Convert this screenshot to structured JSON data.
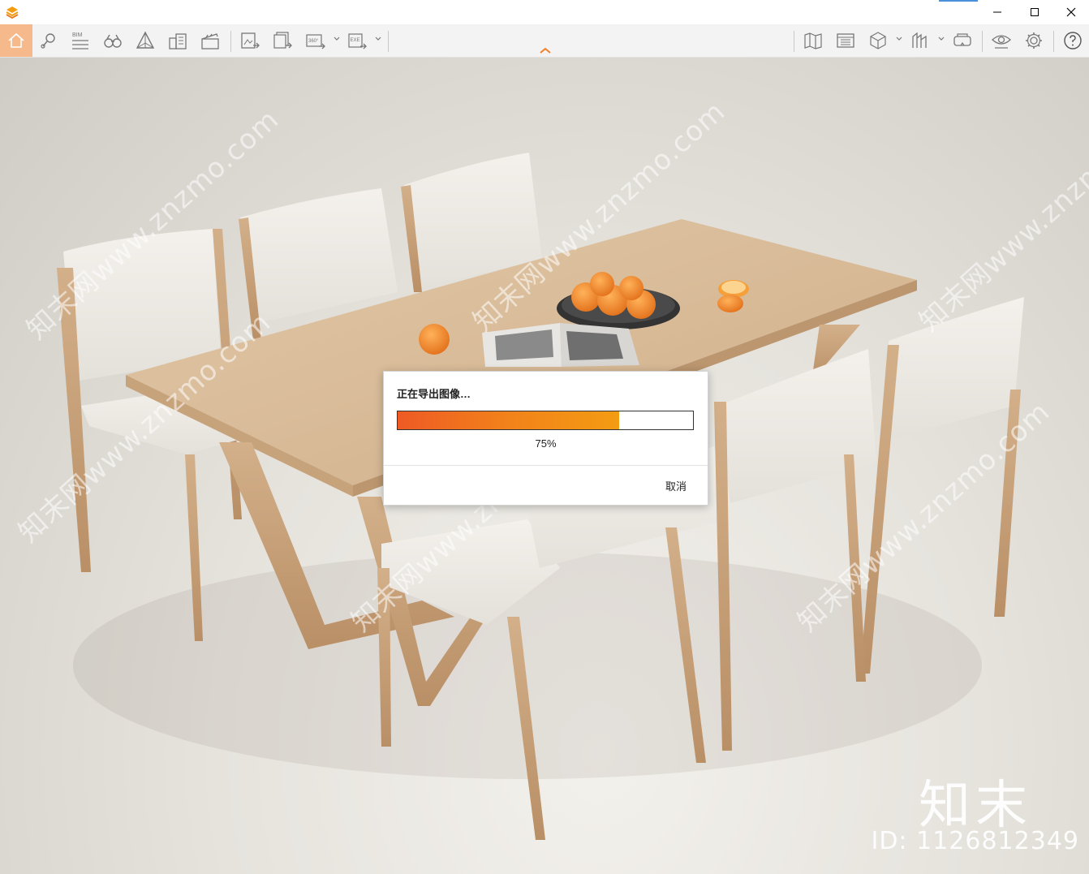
{
  "titlebar": {
    "controls": [
      "minimize",
      "maximize",
      "close"
    ]
  },
  "toolbar": {
    "bim_label": "BIM",
    "pano_label": "360°",
    "exe_label": "EXE",
    "left_tools": [
      "home-icon",
      "locate-pin-icon",
      "bim-icon",
      "binoculars-icon",
      "triangle-view-icon",
      "buildings-icon",
      "clapper-icon",
      "export-image-icon",
      "export-multi-image-icon",
      "export-360-icon",
      "export-exe-icon"
    ],
    "right_tools": [
      "map-icon",
      "layout-panel-icon",
      "cube-icon",
      "section-icon",
      "vr-headset-icon",
      "eye-icon",
      "gear-icon",
      "help-icon"
    ],
    "active_tool": "home-icon",
    "accent_color": "#f6b98c",
    "chevron_color": "#f07f28"
  },
  "dialog": {
    "title": "正在导出图像…",
    "progress": 0.75,
    "progress_text": "75%",
    "cancel_label": "取消"
  },
  "watermarks": {
    "diagonal_text": "知末网www.znzmo.com",
    "brand": "知末",
    "id_text": "ID: 1126812349"
  }
}
